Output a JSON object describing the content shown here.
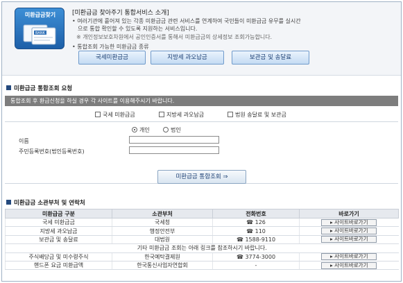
{
  "intro": {
    "logo_title": "미환급금찾기",
    "logo_pic_text": "BANK",
    "title": "[미환급금 찾아주기 통합서비스 소개]",
    "line1": "• 여러기관에 흩어져 있는 각종 미환급금 관련 서비스를 연계하여 국민들이 미환급금 유무를 실시간",
    "line2": "으로 통합 확인할 수 있도록 지원하는 서비스입니다.",
    "note": "※ 개인정보보호차원에서 공인인증서를 통해서 미환급금의 상세정보 조회가능합니다.",
    "available": "• 통합조회 가능한 미환급금 종류",
    "buttons": [
      "국세미환급금",
      "지방세 과오납금",
      "보관금 및 송달료"
    ]
  },
  "search_section": {
    "title": "미환급금 통합조회 요청",
    "banner": "통합조회 후 환급신청을 하실 경우 각 사이트를 이용해주시기 바랍니다.",
    "checkboxes": [
      "국세 미환급금",
      "지방세 과오납금",
      "법원 송달료 및 보관금"
    ],
    "radios": [
      "개인",
      "법인"
    ],
    "name_label": "이름",
    "id_label": "주민등록번호(법인등록번호)",
    "search_button": "미환급금 통합조회 ⇒"
  },
  "dept_section": {
    "title": "미환급금 소관부처 및 연락처",
    "headers": [
      "미환급금 구분",
      "소관부처",
      "전화번호",
      "바로가기"
    ],
    "rows": [
      {
        "kind": "국세 미환급금",
        "dept": "국세청",
        "phone": "☎ 126",
        "link": "▸ 사이트바로가기"
      },
      {
        "kind": "지방세 과오납금",
        "dept": "행정안전부",
        "phone": "☎ 110",
        "link": "▸ 사이트바로가기"
      },
      {
        "kind": "보관금 및 송달료",
        "dept": "대법원",
        "phone": "☎ 1588-9110",
        "link": "▸ 사이트바로가기"
      }
    ],
    "merged_note": "기타 미환급금 조회는 아래 링크를 참조하시기 바랍니다.",
    "rows2": [
      {
        "kind": "주식배당금 및 미수령주식",
        "dept": "한국예탁결제원",
        "phone": "☎ 3774-3000",
        "link": "▸ 사이트바로가기"
      },
      {
        "kind": "핸드폰 요금 미환급액",
        "dept": "한국통신사업자연합회",
        "phone": "-",
        "link": "▸ 사이트바로가기"
      }
    ]
  }
}
